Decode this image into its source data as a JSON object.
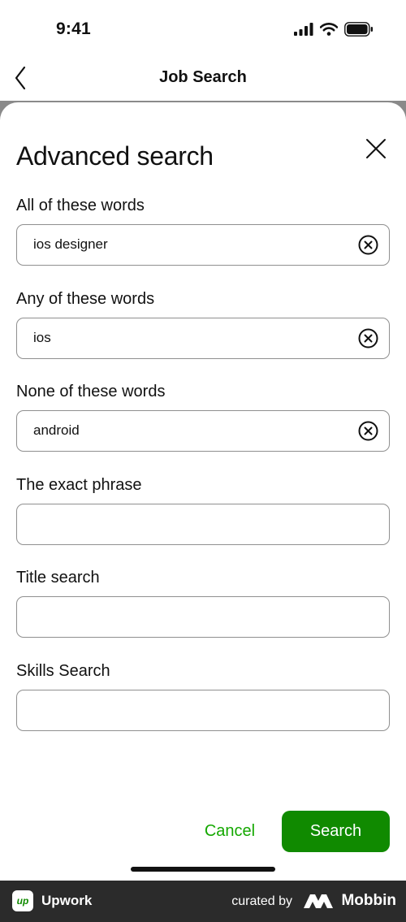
{
  "status_bar": {
    "time": "9:41"
  },
  "header": {
    "title": "Job Search"
  },
  "sheet": {
    "title": "Advanced search",
    "fields": [
      {
        "label": "All of these words",
        "value": "ios designer",
        "placeholder": ""
      },
      {
        "label": "Any of these words",
        "value": "ios",
        "placeholder": ""
      },
      {
        "label": "None of these words",
        "value": "android",
        "placeholder": ""
      },
      {
        "label": "The exact phrase",
        "value": "",
        "placeholder": ""
      },
      {
        "label": "Title search",
        "value": "",
        "placeholder": ""
      },
      {
        "label": "Skills Search",
        "value": "",
        "placeholder": ""
      }
    ],
    "cancel_label": "Cancel",
    "search_label": "Search"
  },
  "branding": {
    "app_name": "Upwork",
    "app_logo_text": "up",
    "curated_by": "curated by",
    "curator": "Mobbin"
  },
  "colors": {
    "accent_green": "#14a800",
    "button_green": "#108a00",
    "brand_bar": "#2b2b2b"
  },
  "icons": {
    "back": "chevron-left-icon",
    "close": "close-icon",
    "clear": "clear-circle-icon",
    "signal": "cellular-signal-icon",
    "wifi": "wifi-icon",
    "battery": "battery-icon"
  }
}
